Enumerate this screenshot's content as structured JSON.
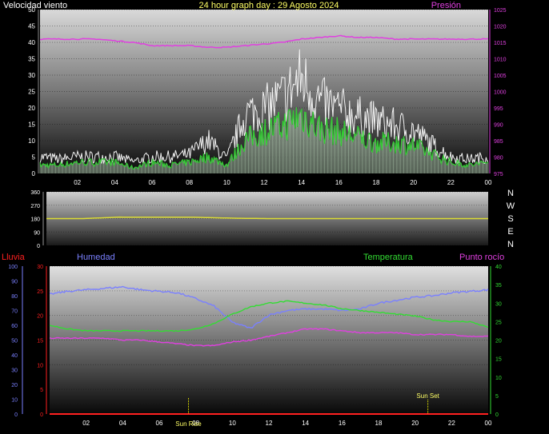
{
  "title": "24 hour graph day : 29 Agosto 2024",
  "labels": {
    "wind": "Velocidad viento",
    "pressure": "Presión",
    "rain": "Lluvia",
    "humidity": "Humedad",
    "temperature": "Temperatura",
    "dewpoint": "Punto rocío",
    "compass": [
      "N",
      "W",
      "S",
      "E",
      "N"
    ],
    "sun_rise": "Sun Rise",
    "sun_set": "Sun Set"
  },
  "colors": {
    "wind_label": "#ffffff",
    "title": "#ffff66",
    "pressure": "#e040e0",
    "rain": "#ff2020",
    "humidity": "#7a80ff",
    "temperature": "#33dd33",
    "dewpoint": "#e040e0",
    "direction": "#dddd33",
    "gust": "#f2f2f2",
    "wind_avg": "#33cc33",
    "wind_fill": "#d6f5d6",
    "sun_line": "#ffff00"
  },
  "x_ticks": [
    "02",
    "04",
    "06",
    "08",
    "10",
    "12",
    "14",
    "16",
    "18",
    "20",
    "22",
    "00"
  ],
  "chart_data": [
    {
      "type": "line",
      "name": "wind_pressure",
      "title": "24 hour graph day : 29 Agosto 2024",
      "x_range_hours": [
        0,
        24
      ],
      "y_left": {
        "label": "Velocidad viento",
        "range": [
          0,
          50
        ],
        "ticks": [
          0,
          5,
          10,
          15,
          20,
          25,
          30,
          35,
          40,
          45,
          50
        ]
      },
      "y_right": {
        "label": "Presión",
        "range": [
          975,
          1025
        ],
        "ticks": [
          975,
          980,
          985,
          990,
          995,
          1000,
          1005,
          1010,
          1015,
          1020,
          1025
        ]
      },
      "series": [
        {
          "name": "Presión",
          "axis": "right",
          "x": [
            0,
            1,
            2,
            3,
            4,
            5,
            6,
            7,
            8,
            9,
            10,
            11,
            12,
            13,
            14,
            15,
            16,
            17,
            18,
            19,
            20,
            21,
            22,
            23,
            24
          ],
          "values": [
            1016,
            1016,
            1016,
            1016,
            1015.5,
            1015,
            1014,
            1014,
            1014,
            1013.5,
            1013.5,
            1014,
            1014.5,
            1015,
            1016,
            1016.5,
            1017,
            1016.5,
            1016.5,
            1016,
            1016,
            1016,
            1016,
            1016,
            1016
          ]
        }
      ],
      "gust_envelope": {
        "x": [
          0,
          1,
          2,
          3,
          4,
          5,
          6,
          7,
          8,
          9,
          10,
          11,
          12,
          13,
          14,
          15,
          16,
          17,
          18,
          19,
          20,
          21,
          22,
          23,
          24
        ],
        "max": [
          7,
          6,
          7,
          7,
          7,
          5,
          7,
          7,
          8,
          14,
          6,
          25,
          27,
          32,
          40,
          30,
          27,
          24,
          22,
          20,
          18,
          12,
          7,
          6,
          7
        ],
        "avg": [
          3,
          3,
          4,
          4,
          4,
          2,
          4,
          3,
          4,
          6,
          3,
          12,
          15,
          17,
          21,
          16,
          15,
          13,
          11,
          11,
          10,
          7,
          4,
          3,
          4
        ]
      }
    },
    {
      "type": "line",
      "name": "wind_direction",
      "x_range_hours": [
        0,
        24
      ],
      "y_left": {
        "range": [
          0,
          360
        ],
        "ticks": [
          0,
          90,
          180,
          270,
          360
        ]
      },
      "y_right": {
        "ticks": [
          "N",
          "W",
          "S",
          "E",
          "N"
        ]
      },
      "series": [
        {
          "name": "direction",
          "x": [
            0,
            2,
            4,
            6,
            8,
            10,
            12,
            14,
            16,
            18,
            20,
            22,
            24
          ],
          "values": [
            180,
            180,
            190,
            189,
            189,
            183,
            180,
            180,
            180,
            180,
            180,
            180,
            180
          ]
        }
      ]
    },
    {
      "type": "line",
      "name": "temp_humidity",
      "x_range_hours": [
        0,
        24
      ],
      "y_left_rain": {
        "label": "Lluvia",
        "range": [
          0,
          30
        ],
        "ticks": [
          0,
          5,
          10,
          15,
          20,
          25,
          30
        ]
      },
      "y_left_humidity": {
        "label": "Humedad",
        "range": [
          0,
          100
        ],
        "ticks": [
          0,
          10,
          20,
          30,
          40,
          50,
          60,
          70,
          80,
          90,
          100
        ]
      },
      "y_right": {
        "label": "Temperatura",
        "range": [
          0,
          40
        ],
        "ticks": [
          0,
          5,
          10,
          15,
          20,
          25,
          30,
          35,
          40
        ]
      },
      "series": [
        {
          "name": "Humedad",
          "axis": "humidity",
          "x": [
            0,
            1,
            2,
            3,
            4,
            5,
            6,
            7,
            8,
            9,
            10,
            11,
            12,
            13,
            14,
            15,
            16,
            17,
            18,
            19,
            20,
            21,
            22,
            23,
            24
          ],
          "values": [
            81,
            83,
            84,
            85,
            86,
            84,
            83,
            82,
            78,
            73,
            62,
            58,
            67,
            70,
            71,
            71,
            70,
            71,
            75,
            77,
            79,
            80,
            82,
            83,
            84
          ]
        },
        {
          "name": "Temperatura",
          "axis": "right",
          "x": [
            0,
            1,
            2,
            3,
            4,
            5,
            6,
            7,
            8,
            9,
            10,
            11,
            12,
            13,
            14,
            15,
            16,
            17,
            18,
            19,
            20,
            21,
            22,
            23,
            24
          ],
          "values": [
            24,
            23,
            22.5,
            22.5,
            22.5,
            22.5,
            22.5,
            22.5,
            23,
            24.5,
            27,
            29,
            30,
            30.5,
            30,
            29.5,
            28.5,
            28,
            27.5,
            27,
            26.5,
            25.5,
            25,
            25,
            23.5
          ]
        },
        {
          "name": "Punto rocío",
          "axis": "right",
          "x": [
            0,
            1,
            2,
            3,
            4,
            5,
            6,
            7,
            8,
            9,
            10,
            11,
            12,
            13,
            14,
            15,
            16,
            17,
            18,
            19,
            20,
            21,
            22,
            23,
            24
          ],
          "values": [
            20.5,
            20.5,
            20.5,
            20.5,
            20,
            20,
            19.5,
            19,
            18.5,
            18.5,
            19.5,
            20,
            21,
            22,
            23,
            23,
            22.5,
            22,
            22,
            22,
            21.5,
            21.5,
            21.5,
            21,
            21
          ]
        },
        {
          "name": "Lluvia",
          "axis": "rain",
          "x": [
            0,
            24
          ],
          "values": [
            0,
            0
          ]
        }
      ],
      "sun_rise_hour": 7.6,
      "sun_set_hour": 20.7
    }
  ]
}
